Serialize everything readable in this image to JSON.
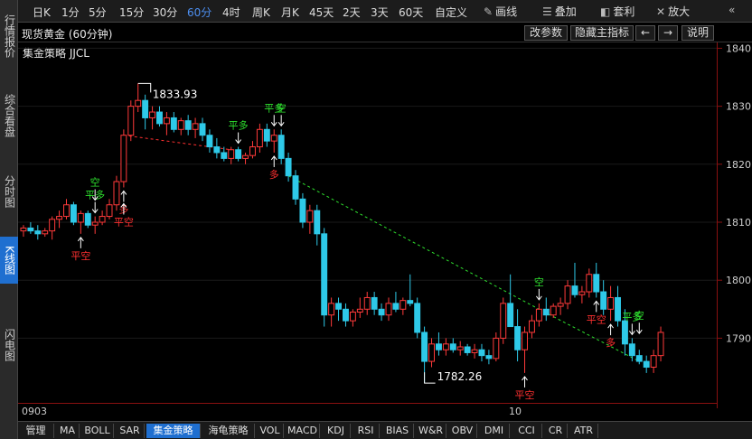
{
  "sidebar": {
    "tabs": [
      {
        "label": "行情报价",
        "active": false
      },
      {
        "label": "综合看盘",
        "active": false
      },
      {
        "label": "分时图",
        "active": false
      },
      {
        "label": "K线图",
        "active": true
      },
      {
        "label": "闪电图",
        "active": false
      }
    ]
  },
  "toolbar": {
    "timeframes": [
      "日K",
      "1分",
      "5分",
      "15分",
      "30分",
      "60分",
      "4时",
      "周K",
      "月K",
      "45天",
      "2天",
      "3天",
      "60天",
      "自定义"
    ],
    "active_timeframe": "60分",
    "tools": [
      {
        "label": "画线",
        "icon": "pencil-icon"
      },
      {
        "label": "叠加",
        "icon": "layers-icon"
      },
      {
        "label": "套利",
        "icon": "arbitrage-icon"
      },
      {
        "label": "放大",
        "icon": "zoom-in-icon"
      }
    ]
  },
  "chart_header": {
    "title": "现货黄金 (60分钟)",
    "buttons": [
      "改参数",
      "隐藏主指标",
      "←",
      "→",
      "说明"
    ]
  },
  "indicator": "集金策略 JJCL",
  "price_axis": {
    "ticks": [
      "1840.0",
      "1830.0",
      "1820.0",
      "1810.0",
      "1800.0",
      "1790.0"
    ],
    "values": [
      1840,
      1830,
      1820,
      1810,
      1800,
      1790
    ]
  },
  "date_axis": {
    "labels": [
      "0903",
      "10"
    ]
  },
  "chart_data": {
    "type": "candlestick",
    "symbol": "现货黄金",
    "interval": "60分钟",
    "ylim": [
      1779,
      1841
    ],
    "max_label": "1833.93",
    "min_label": "1782.26",
    "max_value": 1833.93,
    "min_value": 1782.26,
    "candles": [
      [
        1808.5,
        1809.5,
        1807.5,
        1809
      ],
      [
        1809,
        1810,
        1808,
        1808.5
      ],
      [
        1808.5,
        1809.5,
        1807,
        1808
      ],
      [
        1808,
        1809,
        1807.5,
        1808.5
      ],
      [
        1808.5,
        1811,
        1807,
        1810.5
      ],
      [
        1810.5,
        1812,
        1809,
        1811
      ],
      [
        1811,
        1814,
        1810.5,
        1813
      ],
      [
        1813,
        1813.5,
        1809.5,
        1810
      ],
      [
        1810,
        1812,
        1808,
        1811.5
      ],
      [
        1811.5,
        1812,
        1809,
        1809.5
      ],
      [
        1809.5,
        1811,
        1808,
        1810
      ],
      [
        1810,
        1812,
        1809.5,
        1811
      ],
      [
        1811,
        1814,
        1810.5,
        1813
      ],
      [
        1813,
        1818,
        1812,
        1817
      ],
      [
        1817,
        1826,
        1816,
        1825
      ],
      [
        1825,
        1831,
        1824,
        1830
      ],
      [
        1830,
        1833.93,
        1829,
        1831
      ],
      [
        1831,
        1832,
        1826,
        1828
      ],
      [
        1828,
        1830,
        1826,
        1829
      ],
      [
        1829,
        1830,
        1826.5,
        1827
      ],
      [
        1827,
        1829,
        1825,
        1828
      ],
      [
        1828,
        1829,
        1825.5,
        1826
      ],
      [
        1826,
        1828,
        1825,
        1827.5
      ],
      [
        1827.5,
        1828.5,
        1825,
        1826
      ],
      [
        1826,
        1828,
        1824.5,
        1827
      ],
      [
        1827,
        1828,
        1824,
        1825
      ],
      [
        1825,
        1826,
        1822,
        1823
      ],
      [
        1823,
        1824.5,
        1821,
        1822
      ],
      [
        1822,
        1823,
        1820.5,
        1821
      ],
      [
        1821,
        1823,
        1820,
        1822.5
      ],
      [
        1822.5,
        1823,
        1820.5,
        1821
      ],
      [
        1821,
        1822,
        1820,
        1821.5
      ],
      [
        1821.5,
        1824,
        1821,
        1823
      ],
      [
        1823,
        1827,
        1822,
        1826
      ],
      [
        1826,
        1827,
        1823,
        1824
      ],
      [
        1824,
        1826,
        1822,
        1825
      ],
      [
        1825,
        1826,
        1820,
        1821
      ],
      [
        1821,
        1822,
        1817,
        1818
      ],
      [
        1818,
        1819,
        1813,
        1814
      ],
      [
        1814,
        1815,
        1809,
        1810
      ],
      [
        1810,
        1813,
        1808,
        1812
      ],
      [
        1812,
        1813,
        1806,
        1808
      ],
      [
        1808,
        1809,
        1792,
        1794
      ],
      [
        1794,
        1797,
        1792,
        1796
      ],
      [
        1796,
        1797,
        1793,
        1795
      ],
      [
        1795,
        1796,
        1792,
        1793
      ],
      [
        1793,
        1795,
        1792,
        1794.5
      ],
      [
        1794.5,
        1797,
        1793.5,
        1795
      ],
      [
        1795,
        1798,
        1794,
        1797
      ],
      [
        1797,
        1798,
        1794,
        1795
      ],
      [
        1795,
        1796,
        1793,
        1794
      ],
      [
        1794,
        1797,
        1793,
        1796
      ],
      [
        1796,
        1798,
        1794.5,
        1795
      ],
      [
        1795,
        1797,
        1794,
        1796.5
      ],
      [
        1796.5,
        1801,
        1795.5,
        1796
      ],
      [
        1796,
        1797,
        1790,
        1791
      ],
      [
        1791,
        1792,
        1782.26,
        1786
      ],
      [
        1786,
        1790,
        1785,
        1789
      ],
      [
        1789,
        1791,
        1787,
        1788
      ],
      [
        1788,
        1790,
        1787,
        1789
      ],
      [
        1789,
        1790,
        1787.5,
        1788
      ],
      [
        1788,
        1789.5,
        1787,
        1788.5
      ],
      [
        1788.5,
        1789,
        1787,
        1787.5
      ],
      [
        1787.5,
        1789,
        1786.5,
        1788
      ],
      [
        1788,
        1789,
        1786,
        1787
      ],
      [
        1787,
        1788,
        1785.5,
        1786.5
      ],
      [
        1786.5,
        1791,
        1786,
        1790
      ],
      [
        1790,
        1797,
        1789,
        1796
      ],
      [
        1796,
        1801,
        1794,
        1792
      ],
      [
        1792,
        1795,
        1786,
        1788
      ],
      [
        1788,
        1792,
        1784,
        1791
      ],
      [
        1791,
        1794,
        1790,
        1793
      ],
      [
        1793,
        1796,
        1792,
        1795
      ],
      [
        1795,
        1797,
        1793,
        1794
      ],
      [
        1794,
        1796,
        1793.5,
        1795.5
      ],
      [
        1795.5,
        1797,
        1794,
        1796
      ],
      [
        1796,
        1800,
        1795,
        1799
      ],
      [
        1799,
        1803,
        1797,
        1797.5
      ],
      [
        1797.5,
        1799,
        1796,
        1798
      ],
      [
        1798,
        1802,
        1797,
        1801
      ],
      [
        1801,
        1803,
        1797,
        1798
      ],
      [
        1798,
        1800,
        1794,
        1795
      ],
      [
        1795,
        1799,
        1793,
        1797
      ],
      [
        1797,
        1799,
        1792,
        1793
      ],
      [
        1793,
        1795,
        1787,
        1789
      ],
      [
        1789,
        1790,
        1786,
        1787
      ],
      [
        1787,
        1788,
        1785.5,
        1786
      ],
      [
        1786,
        1787,
        1784,
        1785
      ],
      [
        1785,
        1788,
        1784,
        1787
      ],
      [
        1787,
        1792,
        1786,
        1791
      ]
    ]
  },
  "signals": [
    {
      "index": 8,
      "text": "平空",
      "color": "#ff3030",
      "pos": "below"
    },
    {
      "index": 10,
      "text": "平多",
      "color": "#2ee02e",
      "pos": "above"
    },
    {
      "index": 10,
      "text": "空",
      "color": "#2ee02e",
      "pos": "above2"
    },
    {
      "index": 14,
      "text": "多",
      "color": "#ff3030",
      "pos": "below"
    },
    {
      "index": 14,
      "text": "平空",
      "color": "#ff3030",
      "pos": "below2"
    },
    {
      "index": 30,
      "text": "平多",
      "color": "#2ee02e",
      "pos": "above"
    },
    {
      "index": 35,
      "text": "平多",
      "color": "#2ee02e",
      "pos": "above"
    },
    {
      "index": 36,
      "text": "空",
      "color": "#2ee02e",
      "pos": "above"
    },
    {
      "index": 35,
      "text": "多",
      "color": "#ff3030",
      "pos": "below"
    },
    {
      "index": 70,
      "text": "平空",
      "color": "#ff3030",
      "pos": "below"
    },
    {
      "index": 72,
      "text": "空",
      "color": "#2ee02e",
      "pos": "above"
    },
    {
      "index": 80,
      "text": "平空",
      "color": "#ff3030",
      "pos": "below"
    },
    {
      "index": 82,
      "text": "多",
      "color": "#ff3030",
      "pos": "below"
    },
    {
      "index": 85,
      "text": "平多",
      "color": "#2ee02e",
      "pos": "above"
    },
    {
      "index": 86,
      "text": "空",
      "color": "#2ee02e",
      "pos": "above2"
    }
  ],
  "trend_lines": [
    {
      "from": 14,
      "to": 29,
      "color": "#ff3030"
    },
    {
      "from": 37,
      "to": 72,
      "color": "#2ee02e"
    },
    {
      "from": 72,
      "to": 86,
      "color": "#2ee02e"
    }
  ],
  "colors": {
    "up": "#ff3a3a",
    "down": "#2ec9e8",
    "axis": "#8a1010",
    "active": "#1f6fd0",
    "green_signal": "#2ee02e",
    "red_signal": "#ff3030"
  },
  "bottom_tabs": [
    "管理",
    "MA",
    "BOLL",
    "SAR",
    "集金策略",
    "海龟策略",
    "VOL",
    "MACD",
    "KDJ",
    "RSI",
    "BIAS",
    "W&R",
    "OBV",
    "DMI",
    "CCI",
    "CR",
    "ATR"
  ],
  "bottom_active": "集金策略"
}
